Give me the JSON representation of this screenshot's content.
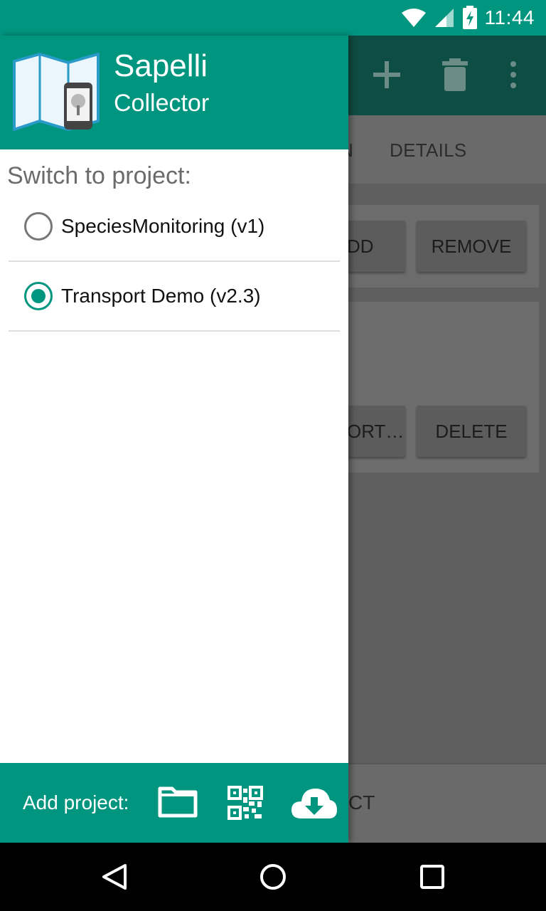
{
  "status_bar": {
    "time": "11:44",
    "icons": [
      "wifi-icon",
      "signal-icon",
      "battery-charging-icon"
    ]
  },
  "background_app": {
    "toolbar_icons": [
      "add-icon",
      "delete-icon",
      "overflow-menu-icon"
    ],
    "tabs": [
      "N",
      "DETAILS"
    ],
    "card1_buttons": [
      "DD",
      "REMOVE"
    ],
    "card2_buttons": [
      "ORT…",
      "DELETE"
    ],
    "bottom_text": "CT"
  },
  "drawer": {
    "header": {
      "title": "Sapelli",
      "subtitle": "Collector",
      "logo_icon": "sapelli-logo-icon"
    },
    "switch_label": "Switch to project:",
    "projects": [
      {
        "label": "SpeciesMonitoring (v1)",
        "selected": false
      },
      {
        "label": "Transport Demo (v2.3)",
        "selected": true
      }
    ],
    "footer": {
      "add_label": "Add project:",
      "icons": [
        "folder-icon",
        "qr-code-icon",
        "cloud-download-icon"
      ]
    }
  },
  "nav_bar": {
    "icons": [
      "back-icon",
      "home-icon",
      "recents-icon"
    ]
  },
  "colors": {
    "primary": "#00957f",
    "primary_dark_dimmed": "#0e4d43"
  }
}
